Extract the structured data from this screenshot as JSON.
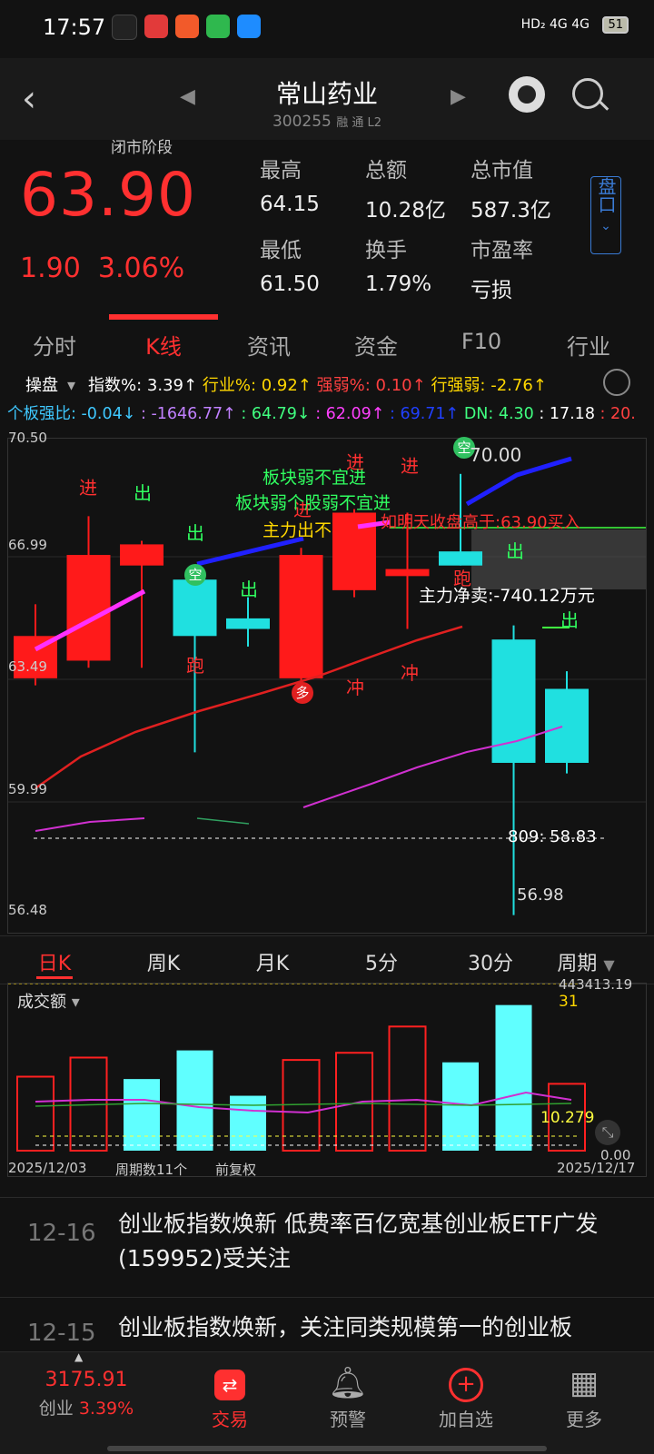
{
  "status": {
    "time": "17:57",
    "network": "HD₂  4G 4G",
    "battery": "51"
  },
  "header": {
    "title": "常山药业",
    "code": "300255",
    "badges": "融 通 L2"
  },
  "quote": {
    "phase": "闭市阶段",
    "price": "63.90",
    "change": "1.90",
    "change_pct": "3.06%",
    "stats": [
      {
        "label": "最高",
        "value": "64.15"
      },
      {
        "label": "总额",
        "value": "10.28亿"
      },
      {
        "label": "总市值",
        "value": "587.3亿"
      },
      {
        "label": "最低",
        "value": "61.50"
      },
      {
        "label": "换手",
        "value": "1.79%"
      },
      {
        "label": "市盈率",
        "value": "亏损"
      }
    ],
    "pankou": "盘口"
  },
  "tabs": [
    "分时",
    "K线",
    "资讯",
    "资金",
    "F10",
    "行业"
  ],
  "info": {
    "row1": [
      {
        "text": "操盘",
        "color": "#ffffff"
      },
      {
        "text": "指数%: 3.39↑",
        "color": "#ffffff"
      },
      {
        "text": "行业%: 0.92↑",
        "color": "#ffd700"
      },
      {
        "text": "强弱%: 0.10↑",
        "color": "#ff4040"
      },
      {
        "text": "行强弱: -2.76↑",
        "color": "#ffd700"
      }
    ],
    "row2": [
      {
        "text": "个板强比: -0.04↓",
        "color": "#3fc8ff"
      },
      {
        "text": ": -1646.77↑",
        "color": "#c080ff"
      },
      {
        "text": ": 64.79↓",
        "color": "#40ff80"
      },
      {
        "text": ": 62.09↑",
        "color": "#ff40ff"
      },
      {
        "text": ": 69.71↑",
        "color": "#2040ff"
      },
      {
        "text": "DN: 4.30",
        "color": "#40ff80"
      },
      {
        "text": ": 17.18",
        "color": "#ffffff"
      },
      {
        "text": ": 20.",
        "color": "#ff4040"
      }
    ]
  },
  "kchart": {
    "y_labels": [
      "70.50",
      "66.99",
      "63.49",
      "59.99",
      "56.48"
    ],
    "annotations": {
      "jin": "进",
      "chu": "出",
      "pao": "跑",
      "chong": "冲",
      "kong": "空",
      "duo": "多",
      "weak1": "板块弱不宜进",
      "weak2": "板块弱个股弱不宜进",
      "zhuli_out": "主力出不",
      "buy_hint": "如明天收盘高于:63.90买入",
      "net_sell": "主力净卖:-740.12万元",
      "level_809": "809: 58.83",
      "price_70": "70.00",
      "low_label": "56.98"
    }
  },
  "chart_data": {
    "type": "candlestick",
    "categories": [
      "1",
      "2",
      "3",
      "4",
      "5",
      "6",
      "7",
      "8",
      "9",
      "10",
      "11"
    ],
    "open": [
      63.7,
      64.2,
      66.9,
      64.9,
      65.1,
      63.7,
      66.2,
      66.6,
      66.9,
      64.8,
      63.4
    ],
    "close": [
      64.9,
      67.2,
      67.5,
      66.5,
      65.4,
      67.2,
      68.4,
      66.8,
      67.3,
      61.3,
      61.3
    ],
    "high": [
      65.8,
      68.3,
      67.6,
      66.5,
      66.0,
      67.4,
      68.5,
      68.4,
      69.5,
      65.2,
      63.9
    ],
    "low": [
      63.5,
      64.0,
      64.0,
      61.6,
      64.6,
      63.6,
      66.0,
      65.1,
      66.9,
      56.98,
      61.0
    ],
    "up": [
      true,
      true,
      true,
      false,
      false,
      true,
      true,
      true,
      false,
      false,
      false
    ],
    "ylim": [
      56.48,
      70.5
    ],
    "volume": {
      "values": [
        31,
        39,
        30,
        42,
        23,
        38,
        41,
        52,
        37,
        61,
        28
      ],
      "up": [
        true,
        true,
        false,
        false,
        false,
        true,
        true,
        true,
        false,
        false,
        true
      ],
      "max_label": "443413.19",
      "right_label": "31",
      "ma_label": "10.279",
      "min_label": "0.00"
    }
  },
  "ktabs": [
    "日K",
    "周K",
    "月K",
    "5分",
    "30分",
    "周期"
  ],
  "volume_panel": {
    "title": "成交额",
    "date_start": "2025/12/03",
    "period_count": "周期数11个",
    "adjust": "前复权",
    "date_end": "2025/12/17"
  },
  "news": [
    {
      "date": "12-16",
      "text": "创业板指数焕新 低费率百亿宽基创业板ETF广发(159952)受关注"
    },
    {
      "date": "12-15",
      "text": "创业板指数焕新，关注同类规模第一的创业板"
    }
  ],
  "bottom_nav": {
    "index_value": "3175.91",
    "index_name": "创业",
    "index_pct": "3.39%",
    "items": [
      {
        "label": "交易"
      },
      {
        "label": "预警"
      },
      {
        "label": "加自选"
      },
      {
        "label": "更多"
      }
    ]
  }
}
